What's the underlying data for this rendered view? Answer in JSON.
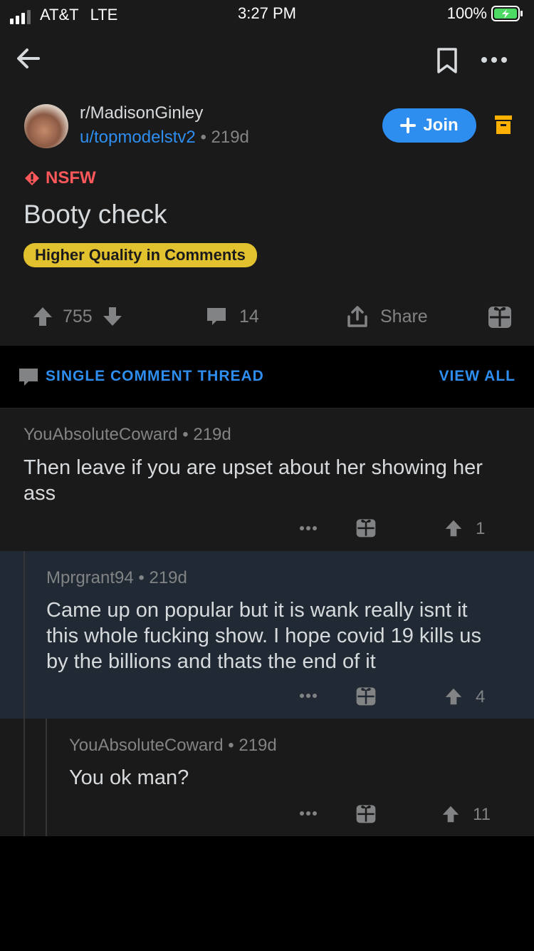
{
  "status_bar": {
    "carrier": "AT&T",
    "network": "LTE",
    "time": "3:27 PM",
    "battery": "100%"
  },
  "post": {
    "subreddit": "r/MadisonGinley",
    "author": "u/topmodelstv2",
    "age": "219d",
    "join_label": "Join",
    "nsfw_label": "NSFW",
    "title": "Booty check",
    "flair": "Higher Quality in Comments",
    "votes": "755",
    "comments": "14",
    "share_label": "Share"
  },
  "thread_banner": {
    "label": "SINGLE COMMENT THREAD",
    "view_all": "VIEW ALL"
  },
  "comments": [
    {
      "author": "YouAbsoluteCoward",
      "age": "219d",
      "lines": [
        "Then leave if you are upset about her showing her",
        "ass"
      ],
      "votes": "1"
    },
    {
      "author": "Mprgrant94",
      "age": "219d",
      "lines": [
        "Came up on popular but it is wank really isnt it",
        "this whole fucking show. I hope covid 19 kills us",
        "by the billions and thats the end of it"
      ],
      "votes": "4"
    },
    {
      "author": "YouAbsoluteCoward",
      "age": "219d",
      "lines": [
        "You ok man?"
      ],
      "votes": "11"
    }
  ],
  "colors": {
    "accent_blue": "#2e8ef0",
    "nsfw_red": "#ff585b",
    "flair_yellow": "#e2c12f",
    "archive_orange": "#ffb000"
  },
  "icons": [
    "back-arrow-icon",
    "bookmark-icon",
    "more-icon",
    "archive-icon",
    "nsfw-warning-icon",
    "upvote-icon",
    "downvote-icon",
    "comment-icon",
    "share-icon",
    "award-icon"
  ]
}
